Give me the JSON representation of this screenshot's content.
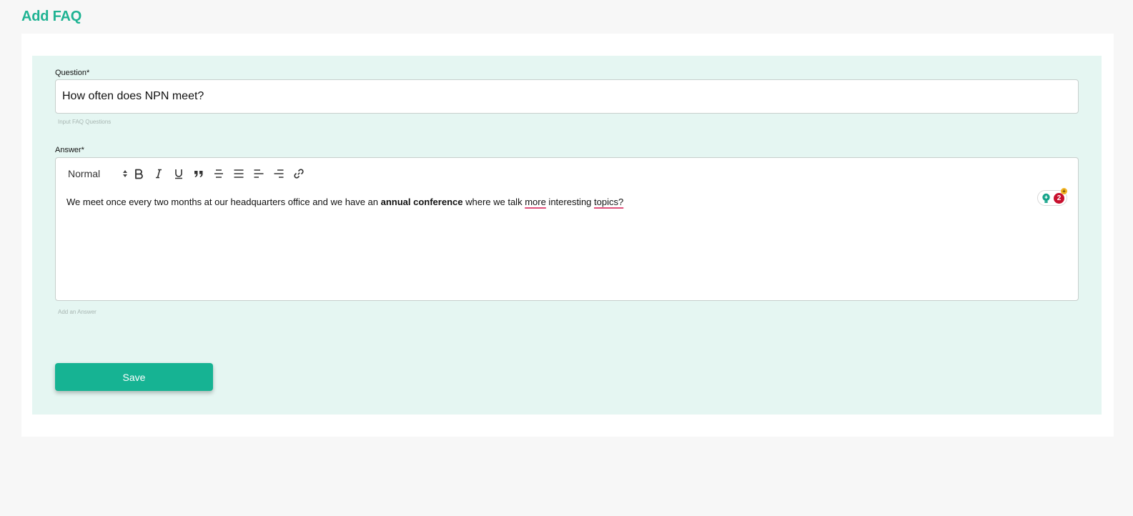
{
  "page": {
    "title": "Add FAQ"
  },
  "form": {
    "question": {
      "label": "Question*",
      "value": "How often does NPN meet?",
      "hint": "Input FAQ Questions"
    },
    "answer": {
      "label": "Answer*",
      "hint": "Add an Answer",
      "format_selected": "Normal",
      "segments": {
        "t1": "We meet once every two months at our headquarters office and we have an ",
        "bold": "annual conference",
        "t2": " where we talk ",
        "misspelled1": "more",
        "t3": " interesting ",
        "misspelled2": "topics?"
      }
    },
    "save_label": "Save"
  },
  "toolbar": {
    "icons": [
      "bold-icon",
      "italic-icon",
      "underline-icon",
      "blockquote-icon",
      "strikethrough-icon",
      "align-justify-icon",
      "align-left-icon",
      "align-right-icon",
      "link-icon"
    ]
  },
  "grammarly": {
    "count": "2"
  },
  "colors": {
    "accent": "#1fb393",
    "panel_bg": "#e5f6f2",
    "button_bg": "#16b393",
    "page_bg": "#f7f7f7",
    "alert": "#c8102e"
  }
}
